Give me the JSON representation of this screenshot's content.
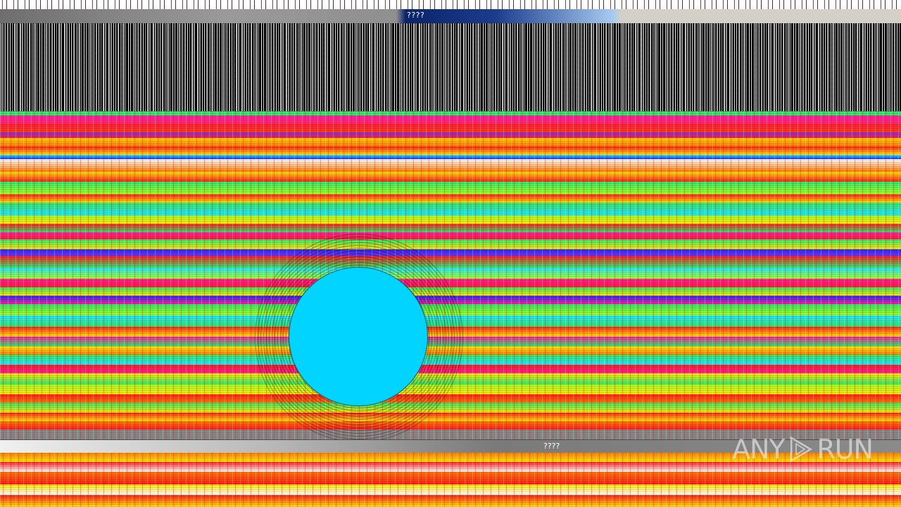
{
  "top_window": {
    "title": "????"
  },
  "bottom_window": {
    "title": "????"
  },
  "watermark": {
    "text_left": "ANY",
    "text_right": "RUN",
    "icon": "play-triangle-icon"
  },
  "colors": {
    "circle": "#00d4ff",
    "titlebar_active": "#0a246a"
  }
}
